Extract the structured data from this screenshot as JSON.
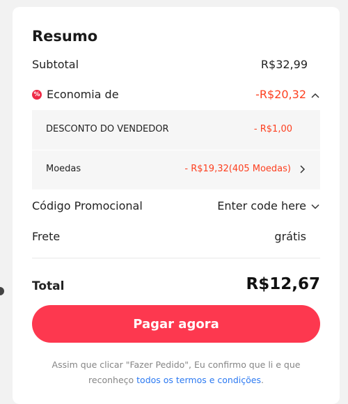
{
  "summary": {
    "title": "Resumo",
    "subtotal": {
      "label": "Subtotal",
      "value": "R$32,99"
    },
    "savings": {
      "icon": "discount-icon",
      "icon_glyph": "%",
      "label": "Economia de",
      "value": "-R$20,32",
      "expanded": true,
      "accent_color": "#fd3f1f"
    },
    "breakdown": [
      {
        "label": "DESCONTO DO VENDEDOR",
        "value": "- R$1,00"
      },
      {
        "label": "Moedas",
        "value": "- R$19,32(405 Moedas)"
      }
    ],
    "promo": {
      "label": "Código Promocional",
      "value": "Enter code here"
    },
    "shipping": {
      "label": "Frete",
      "value": "grátis"
    },
    "total": {
      "label": "Total",
      "value": "R$12,67"
    },
    "pay_button": {
      "label": "Pagar agora",
      "color": "#fd384f"
    },
    "disclaimer": {
      "text": "Assim que clicar \"Fazer Pedido\", Eu confirmo que li e que reconheço",
      "link": "todos os termos e condições",
      "suffix": ".",
      "link_color": "#2b79f2"
    }
  }
}
